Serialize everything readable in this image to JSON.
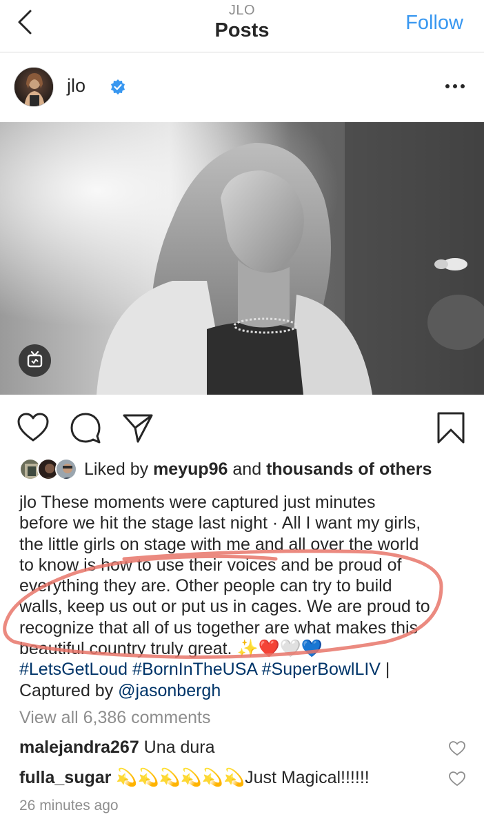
{
  "nav": {
    "account_label": "JLO",
    "title": "Posts",
    "follow_label": "Follow",
    "back_icon": "chevron-left-icon"
  },
  "post": {
    "username": "jlo",
    "verified": true,
    "more_icon": "more-horizontal-icon"
  },
  "actions": {
    "like_icon": "heart-icon",
    "comment_icon": "comment-icon",
    "share_icon": "paper-plane-icon",
    "save_icon": "bookmark-icon"
  },
  "likes": {
    "prefix": "Liked by ",
    "user": "meyup96",
    "middle": " and ",
    "others": "thousands of others"
  },
  "caption": {
    "username": "jlo",
    "line1": "These moments were captured just minutes",
    "line2": "before we hit the stage last night · All I want my girls,",
    "line3": "the little girls on stage with me and all over the world",
    "line4": "to know is how to use their voices and be proud of",
    "line5": "everything they are. Other people can try to build",
    "line6": "walls, keep us out or put us in cages. We are proud to",
    "line7": "recognize that all of us together are what makes this",
    "line8": "beautiful country truly great. ✨❤️🤍💙",
    "hashtag1": "#LetsGetLoud",
    "hashtag2": "#BornInTheUSA",
    "hashtag3": "#SuperBowlLIV",
    "separator": " |",
    "credit_prefix": "Captured by ",
    "credit_mention": "@jasonbergh"
  },
  "comments_link": "View all 6,386 comments",
  "comments": [
    {
      "user": "malejandra267",
      "text": "Una dura"
    },
    {
      "user": "fulla_sugar",
      "text": "💫💫💫💫💫💫Just Magical!!!!!!"
    }
  ],
  "timestamp": "26 minutes ago",
  "colors": {
    "accent": "#3897f0",
    "hashtag": "#003569",
    "muted": "#8e8e8e",
    "annotation": "#e8766a"
  }
}
